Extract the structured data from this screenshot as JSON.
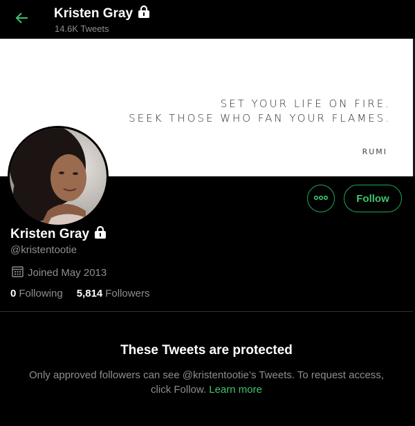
{
  "header": {
    "name": "Kristen Gray",
    "tweet_count": "14.6K Tweets"
  },
  "banner": {
    "line1": "SET YOUR LIFE ON FIRE.",
    "line2": "SEEK THOSE WHO FAN YOUR FLAMES.",
    "attribution": "RUMI"
  },
  "profile": {
    "name": "Kristen Gray",
    "handle": "@kristentootie",
    "joined": "Joined May 2013",
    "following_count": "0",
    "following_label": "Following",
    "followers_count": "5,814",
    "followers_label": "Followers"
  },
  "actions": {
    "follow_label": "Follow"
  },
  "protected": {
    "title": "These Tweets are protected",
    "message": "Only approved followers can see @kristentootie’s Tweets. To request access, click Follow.",
    "learn_more": "Learn more"
  },
  "colors": {
    "accent": "#3ec46d",
    "background": "#000000",
    "muted": "#8e8e8e"
  }
}
